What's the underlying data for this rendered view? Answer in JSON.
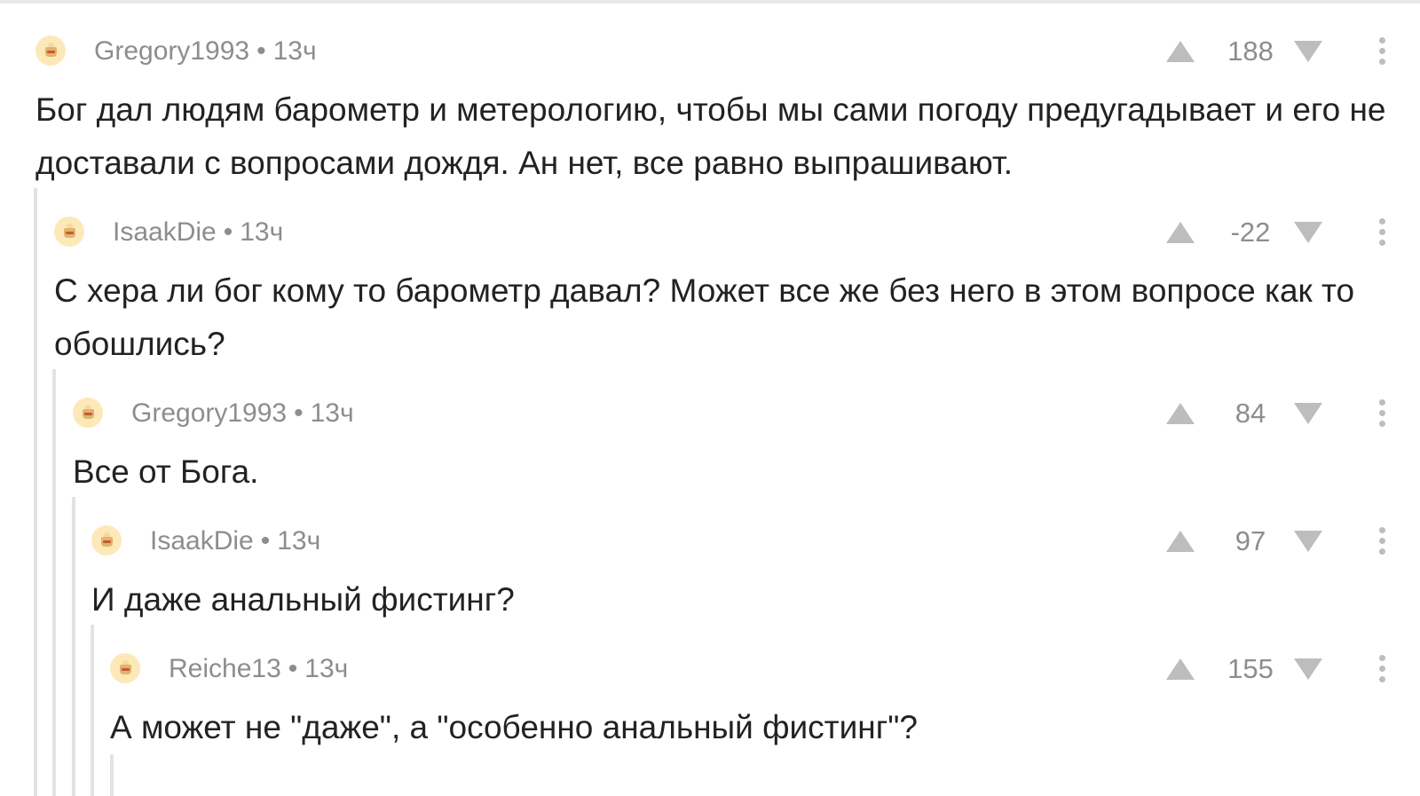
{
  "comments": [
    {
      "author": "Gregory1993",
      "time": "13ч",
      "score": "188",
      "text": "Бог дал людям барометр и метерологию, чтобы мы сами погоду предугадывает и его не доставали с вопросами дождя. Ан нет, все равно выпрашивают."
    },
    {
      "author": "IsaakDie",
      "time": "13ч",
      "score": "-22",
      "text": "С хера ли бог кому то барометр давал? Может все же без него в этом вопросе как то обошлись?"
    },
    {
      "author": "Gregory1993",
      "time": "13ч",
      "score": "84",
      "text": "Все от Бога."
    },
    {
      "author": "IsaakDie",
      "time": "13ч",
      "score": "97",
      "text": "И даже анальный фистинг?"
    },
    {
      "author": "Reiche13",
      "time": "13ч",
      "score": "155",
      "text": "А может не \"даже\", а \"особенно анальный фистинг\"?"
    }
  ],
  "separator": "•",
  "icons": {
    "avatar": "avatar-cup-icon",
    "upvote": "upvote-arrow-icon",
    "downvote": "downvote-arrow-icon",
    "menu": "more-vertical-icon"
  }
}
